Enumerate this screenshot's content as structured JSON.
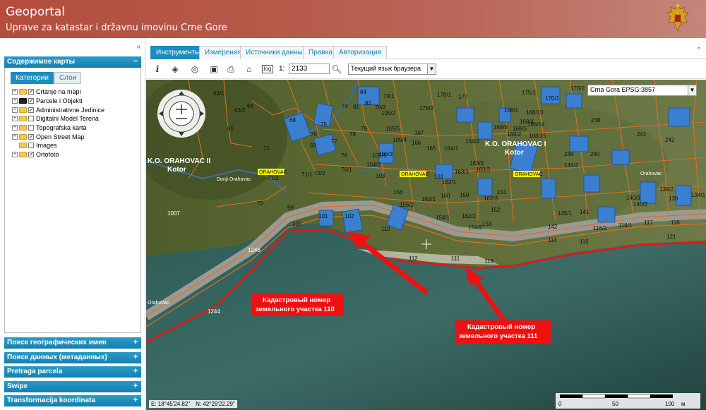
{
  "header": {
    "title": "Geoportal",
    "subtitle": "Uprave za katastar i državnu imovinu Crne Gore"
  },
  "left_panel": {
    "map_contents_title": "Содержимое карты",
    "subtabs": [
      "Категории",
      "Слои"
    ],
    "layers": [
      {
        "label": "Crtanje na mapi",
        "checked": true
      },
      {
        "label": "Parcele i Objekti",
        "checked": true
      },
      {
        "label": "Administrativne Jedinice",
        "checked": true
      },
      {
        "label": "Digitalni Model Terena",
        "checked": false
      },
      {
        "label": "Topografska karta",
        "checked": false
      },
      {
        "label": "Open Street Map",
        "checked": true
      },
      {
        "label": "Images",
        "checked": false
      },
      {
        "label": "Ortofoto",
        "checked": true
      }
    ],
    "sections": [
      "Поиск географических имен",
      "Поиск данных (метаданных)",
      "Pretraga parcela",
      "Swipe",
      "Transformacija koordinata"
    ]
  },
  "top_tabs": [
    "Инструменты",
    "Измерения",
    "Источники данных",
    "Правка",
    "Авторизация"
  ],
  "toolbar": {
    "scale_prefix": "1:",
    "scale_value": "2133",
    "language": "Текущий язык браузера"
  },
  "map": {
    "projection": "Crna Gora EPSG:3857",
    "coord_e": "E: 18°45'24.82\"",
    "coord_n": "N: 42°29'22.29\"",
    "scalebar_labels": [
      "0",
      "50",
      "100",
      "м"
    ],
    "annotation_1": [
      "Кадастровый номер",
      "земельного участка 110"
    ],
    "annotation_2": [
      "Кадастровый номер",
      "земельного участка 111"
    ],
    "area_label_1": "K.O. ORAHOVAC II",
    "area_label_1b": "Kotor",
    "area_label_2": "K.O. ORAHOVAC I",
    "area_label_2b": "Kotor",
    "place_labels": [
      "ORAHOVAC",
      "ORAHOVAC",
      "ORAHOVAC",
      "Donji Orahovac",
      "Orahovac",
      "Orahovac"
    ],
    "parcels": [
      {
        "n": "63/1"
      },
      {
        "n": "63/2"
      },
      {
        "n": "65"
      },
      {
        "n": "66"
      },
      {
        "n": "68"
      },
      {
        "n": "69"
      },
      {
        "n": "70"
      },
      {
        "n": "71"
      },
      {
        "n": "71/1"
      },
      {
        "n": "71/2"
      },
      {
        "n": "72"
      },
      {
        "n": "73/2"
      },
      {
        "n": "74"
      },
      {
        "n": "75"
      },
      {
        "n": "76"
      },
      {
        "n": "76/1"
      },
      {
        "n": "77"
      },
      {
        "n": "78"
      },
      {
        "n": "79"
      },
      {
        "n": "79/1"
      },
      {
        "n": "79/2"
      },
      {
        "n": "81"
      },
      {
        "n": "82"
      },
      {
        "n": "84"
      },
      {
        "n": "99"
      },
      {
        "n": "100"
      },
      {
        "n": "101"
      },
      {
        "n": "102"
      },
      {
        "n": "103"
      },
      {
        "n": "104/2"
      },
      {
        "n": "105/1"
      },
      {
        "n": "105/2"
      },
      {
        "n": "105/3"
      },
      {
        "n": "105/4"
      },
      {
        "n": "105/5"
      },
      {
        "n": "110"
      },
      {
        "n": "111"
      },
      {
        "n": "112"
      },
      {
        "n": "113"
      },
      {
        "n": "114"
      },
      {
        "n": "116"
      },
      {
        "n": "116/1"
      },
      {
        "n": "116/2"
      },
      {
        "n": "117"
      },
      {
        "n": "118"
      },
      {
        "n": "121"
      },
      {
        "n": "134/1"
      },
      {
        "n": "136"
      },
      {
        "n": "138/2"
      },
      {
        "n": "140/2"
      },
      {
        "n": "140/3"
      },
      {
        "n": "141"
      },
      {
        "n": "142"
      },
      {
        "n": "145/1"
      },
      {
        "n": "145/2"
      },
      {
        "n": "151"
      },
      {
        "n": "152"
      },
      {
        "n": "153"
      },
      {
        "n": "154/1"
      },
      {
        "n": "154/2"
      },
      {
        "n": "155/2"
      },
      {
        "n": "156"
      },
      {
        "n": "159"
      },
      {
        "n": "160"
      },
      {
        "n": "161"
      },
      {
        "n": "162/1"
      },
      {
        "n": "162/2"
      },
      {
        "n": "162/3"
      },
      {
        "n": "163/1"
      },
      {
        "n": "163/3"
      },
      {
        "n": "163/5"
      },
      {
        "n": "164/1"
      },
      {
        "n": "164/2"
      },
      {
        "n": "165"
      },
      {
        "n": "166"
      },
      {
        "n": "167"
      },
      {
        "n": "168/1"
      },
      {
        "n": "168/2"
      },
      {
        "n": "168/4"
      },
      {
        "n": "168/5"
      },
      {
        "n": "168/8"
      },
      {
        "n": "168/13"
      },
      {
        "n": "168/14"
      },
      {
        "n": "168/15"
      },
      {
        "n": "170/1"
      },
      {
        "n": "170/2"
      },
      {
        "n": "175/1"
      },
      {
        "n": "177"
      },
      {
        "n": "178/1"
      },
      {
        "n": "178/2"
      },
      {
        "n": "182/1"
      },
      {
        "n": "239"
      },
      {
        "n": "240"
      },
      {
        "n": "241"
      },
      {
        "n": "242"
      },
      {
        "n": "238"
      },
      {
        "n": "1007"
      },
      {
        "n": "1244"
      },
      {
        "n": "1246"
      }
    ]
  },
  "colors": {
    "accent": "#1a8ebc",
    "header": "#b34d3e",
    "parcel_line": "#e07020",
    "annotation_red": "#ee1111"
  }
}
